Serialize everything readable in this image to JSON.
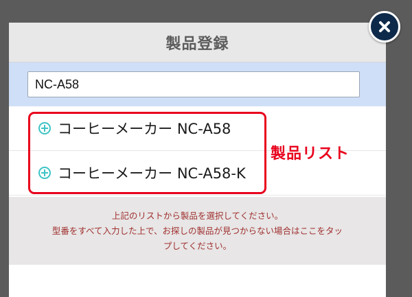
{
  "modal": {
    "title": "製品登録"
  },
  "search": {
    "value": "NC-A58"
  },
  "product_list": {
    "items": [
      {
        "label": "コーヒーメーカー NC-A58",
        "icon": "plus-circle-icon"
      },
      {
        "label": "コーヒーメーカー NC-A58-K",
        "icon": "plus-circle-icon"
      }
    ]
  },
  "annotation": {
    "label": "製品リスト",
    "color": "#e8001c"
  },
  "help": {
    "line1": "上記のリストから製品を選択してください。",
    "line2": "型番をすべて入力した上で、お探しの製品が見つからない場合はここをタッ",
    "line3": "プしてください。"
  },
  "close": {
    "icon": "close-icon"
  },
  "colors": {
    "accent": "#3ec3c5",
    "highlight": "#e8001c",
    "help_text": "#a03030",
    "search_bg": "#cfdff7"
  }
}
